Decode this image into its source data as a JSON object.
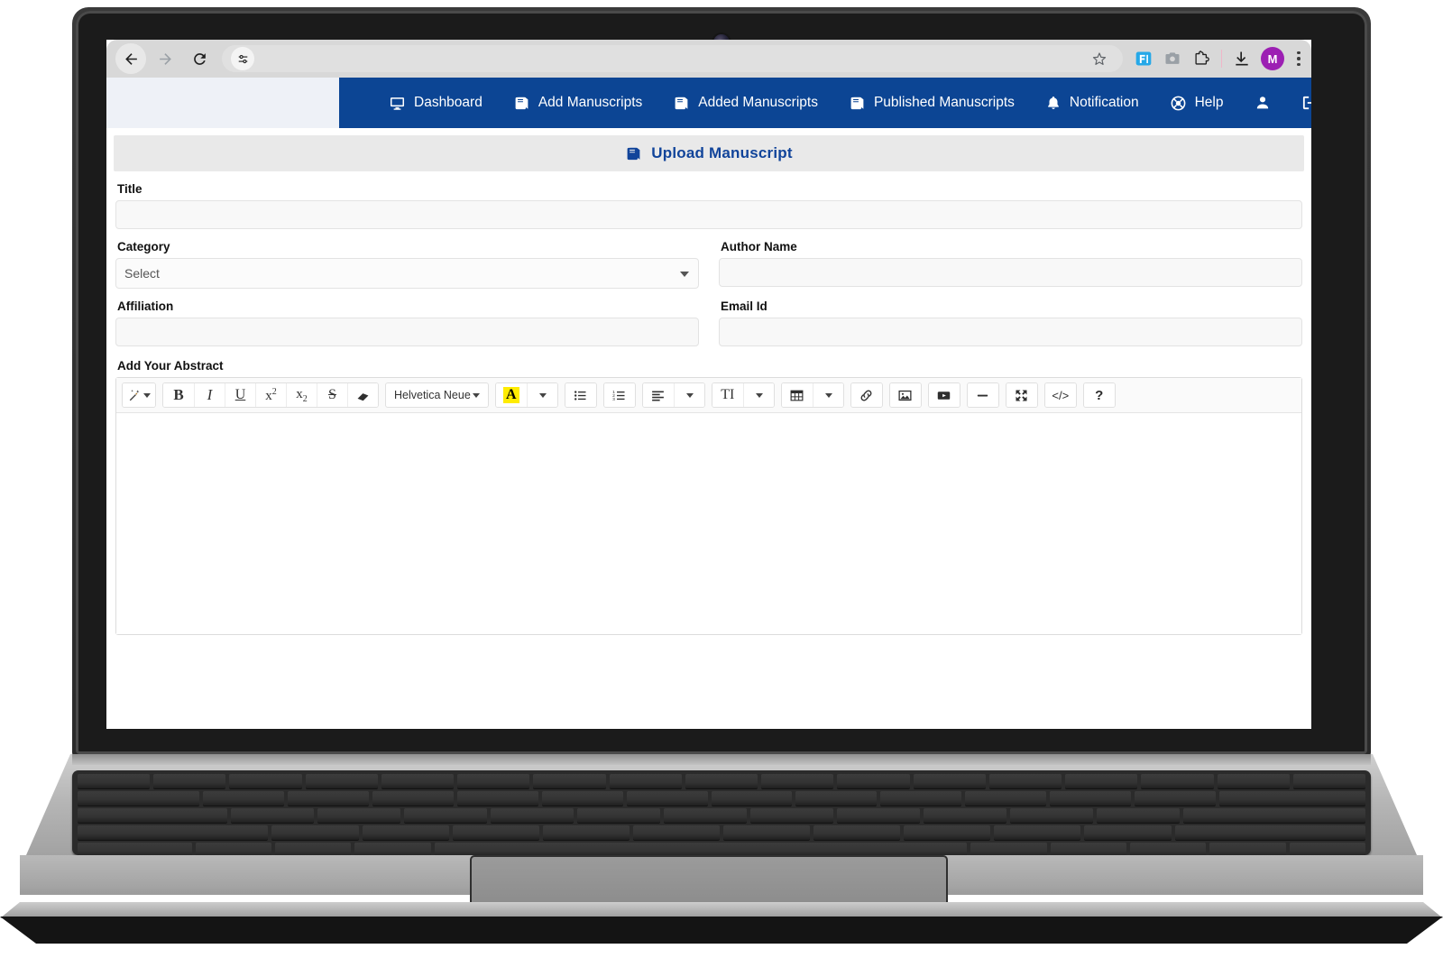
{
  "browser": {
    "back_icon": "back-arrow-icon",
    "forward_icon": "forward-arrow-icon",
    "reload_icon": "reload-icon",
    "omnibox_value": "",
    "omnibox_placeholder": "",
    "tune_icon": "tune-sliders-icon",
    "bookmark_icon": "star-icon",
    "extension_badge_label": "F]",
    "camera_icon": "camera-icon",
    "extensions_icon": "puzzle-piece-icon",
    "download_icon": "download-icon",
    "profile_initial": "M",
    "menu_icon": "three-dot-menu-icon"
  },
  "appnav": {
    "items": [
      {
        "label": "Dashboard",
        "icon": "monitor-icon"
      },
      {
        "label": "Add Manuscripts",
        "icon": "book-icon"
      },
      {
        "label": "Added Manuscripts",
        "icon": "book-icon"
      },
      {
        "label": "Published Manuscripts",
        "icon": "book-icon"
      },
      {
        "label": "Notification",
        "icon": "bell-icon"
      },
      {
        "label": "Help",
        "icon": "lifebuoy-icon"
      }
    ],
    "account_icon": "user-icon",
    "logout_icon": "logout-icon",
    "bar_color": "#0c4594"
  },
  "page_header": {
    "title": "Upload Manuscript",
    "icon": "book-icon",
    "title_color": "#11449a"
  },
  "form": {
    "title": {
      "label": "Title",
      "value": "",
      "placeholder": ""
    },
    "category": {
      "label": "Category",
      "value": "Select",
      "options": [
        "Select"
      ]
    },
    "author_name": {
      "label": "Author Name",
      "value": "",
      "placeholder": ""
    },
    "affiliation": {
      "label": "Affiliation",
      "value": "",
      "placeholder": ""
    },
    "email_id": {
      "label": "Email Id",
      "value": "",
      "placeholder": ""
    },
    "abstract": {
      "label": "Add Your Abstract",
      "value": ""
    }
  },
  "editor_toolbar": {
    "style_button": "style-magic-wand",
    "bold": "B",
    "italic": "I",
    "underline": "U",
    "superscript_base": "x",
    "superscript_exp": "2",
    "subscript_base": "x",
    "subscript_exp": "2",
    "strikethrough": "S",
    "remove_format": "eraser-icon",
    "font_name": "Helvetica Neue",
    "font_color_glyph": "A",
    "font_highlight_color": "#ffec00",
    "unordered_list": "bullet-list-icon",
    "ordered_list": "numbered-list-icon",
    "align": "align-left-icon",
    "line_height": "TI",
    "table": "table-icon",
    "link": "link-icon",
    "image": "image-icon",
    "video": "video-icon",
    "horizontal_rule": "horizontal-rule-icon",
    "fullscreen": "fullscreen-icon",
    "code_view": "</>",
    "help": "?"
  }
}
